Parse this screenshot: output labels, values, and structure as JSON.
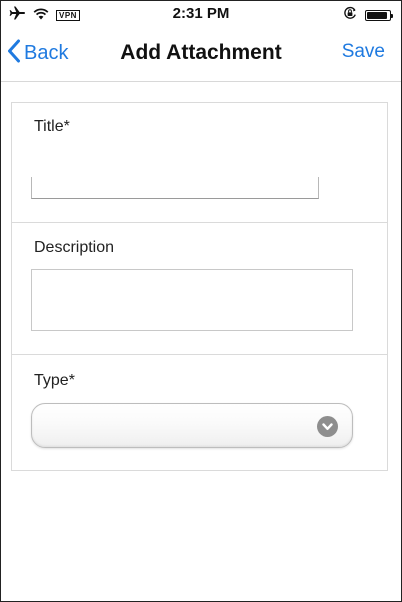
{
  "status_bar": {
    "airplane_icon": "airplane-icon",
    "wifi_icon": "wifi-icon",
    "vpn_label": "VPN",
    "time": "2:31 PM",
    "orientation_lock_icon": "orientation-lock-icon",
    "battery_level": 0.9
  },
  "nav": {
    "back_label": "Back",
    "title": "Add Attachment",
    "save_label": "Save",
    "accent_color": "#1f7ae0"
  },
  "form": {
    "title_field": {
      "label": "Title*",
      "value": ""
    },
    "description_field": {
      "label": "Description",
      "value": ""
    },
    "type_field": {
      "label": "Type*",
      "selected": ""
    }
  }
}
